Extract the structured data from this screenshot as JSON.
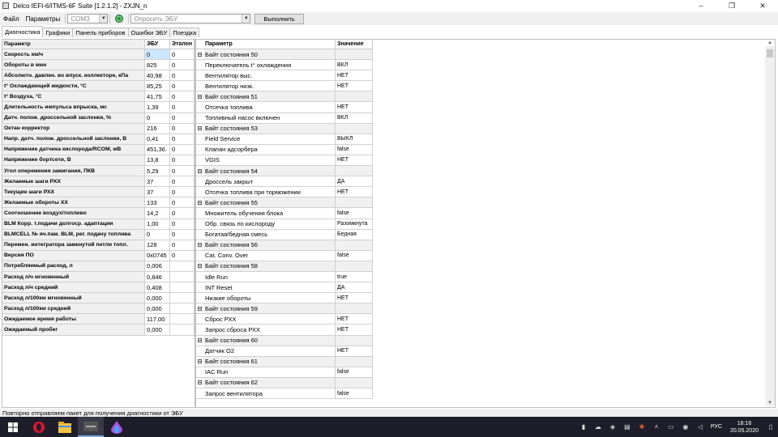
{
  "window": {
    "title": "Delco IEFI-6/ITMS-6F Suite [1.2.1.2] - ZXJN_n",
    "controls": [
      "–",
      "❐",
      "✕"
    ]
  },
  "toolbar": {
    "menu_file": "Файл",
    "menu_params": "Параметры",
    "port_value": "COM3",
    "request_placeholder": "Опросить ЭБУ",
    "run_button": "Выполнить"
  },
  "tabs": [
    "Диагностика",
    "Графики",
    "Панель приборов",
    "Ошибки ЭБУ",
    "Поездка"
  ],
  "left_table": {
    "headers": [
      "Параметр",
      "ЭБУ",
      "Эталон"
    ],
    "rows": [
      [
        "Скорость км/ч",
        "0",
        "0"
      ],
      [
        "Обороты в мин",
        "825",
        "0"
      ],
      [
        "Абсолютн. давлен. во впуск. коллекторе, кПа",
        "40,98",
        "0"
      ],
      [
        "t° Охлаждающей жидкости, °C",
        "85,25",
        "0"
      ],
      [
        "t° Воздуха, °C",
        "41,75",
        "0"
      ],
      [
        "Длительность импульса впрыска, мс",
        "1,39",
        "0"
      ],
      [
        "Датч. полож. дроссельной заслонки, %",
        "0",
        "0"
      ],
      [
        "Октан корректор",
        "216",
        "0"
      ],
      [
        "Напр. датч. полож. дроссельной заслонки, В",
        "0,41",
        "0"
      ],
      [
        "Напряжение датчика кислорода/RCOM, мВ",
        "451,36",
        "0"
      ],
      [
        "Напряжение бортсети, В",
        "13,8",
        "0"
      ],
      [
        "Угол опережения зажигания, ПКВ",
        "5,29",
        "0"
      ],
      [
        "Желаемые шаги РХХ",
        "37",
        "0"
      ],
      [
        "Текущие шаги РХХ",
        "37",
        "0"
      ],
      [
        "Желаемые обороты ХХ",
        "133",
        "0"
      ],
      [
        "Соотношение воздух/топливо",
        "14,2",
        "0"
      ],
      [
        "BLM Корр. т.подачи долгоср. адаптации",
        "1,00",
        "0"
      ],
      [
        "BLMCELL № яч.пам. BLM, рег. подачу топлива",
        "0",
        "0"
      ],
      [
        "Перемен. интегратора замкнутой петли топл.",
        "128",
        "0"
      ],
      [
        "Версия ПО",
        "0x0745",
        "0"
      ],
      [
        "Потребляемый расход, л",
        "0,006",
        ""
      ],
      [
        "Расход л/ч мгновенный",
        "0,846",
        ""
      ],
      [
        "Расход л/ч средний",
        "0,408",
        ""
      ],
      [
        "Расход л/100км мгновенный",
        "0,000",
        ""
      ],
      [
        "Расход л/100км средний",
        "0,000",
        ""
      ],
      [
        "Ожидаемое время работы",
        "117,00",
        ""
      ],
      [
        "Ожидаемый пробег",
        "0,000",
        ""
      ]
    ]
  },
  "right_table": {
    "headers": [
      "Параметр",
      "Значение"
    ],
    "rows": [
      {
        "group": true,
        "name": "Байт состояния 50",
        "value": ""
      },
      {
        "group": false,
        "name": "Переключатель t° охлаждения",
        "value": "ВКЛ"
      },
      {
        "group": false,
        "name": "Вентилятор выс.",
        "value": "НЕТ"
      },
      {
        "group": false,
        "name": "Вентилятор низк.",
        "value": "НЕТ"
      },
      {
        "group": true,
        "name": "Байт состояния 51",
        "value": ""
      },
      {
        "group": false,
        "name": "Отсечка топлива",
        "value": "НЕТ"
      },
      {
        "group": false,
        "name": "Топливный насос включен",
        "value": "ВКЛ"
      },
      {
        "group": true,
        "name": "Байт состояния 53",
        "value": ""
      },
      {
        "group": false,
        "name": "Field Service",
        "value": "ВЫКЛ"
      },
      {
        "group": false,
        "name": "Клапан адсорбера",
        "value": "false"
      },
      {
        "group": false,
        "name": "VGIS",
        "value": "НЕТ"
      },
      {
        "group": true,
        "name": "Байт состояния 54",
        "value": ""
      },
      {
        "group": false,
        "name": "Дроссель закрыт",
        "value": "ДА"
      },
      {
        "group": false,
        "name": "Отсечка топлива при торможении",
        "value": "НЕТ"
      },
      {
        "group": true,
        "name": "Байт состояния 55",
        "value": ""
      },
      {
        "group": false,
        "name": "Множитель обучения блока",
        "value": "false"
      },
      {
        "group": false,
        "name": "Обр. связь по кислороду",
        "value": "Разомкнута"
      },
      {
        "group": false,
        "name": "Богатая/бедная смесь",
        "value": "Бедная"
      },
      {
        "group": true,
        "name": "Байт состояния 56",
        "value": ""
      },
      {
        "group": false,
        "name": "Cat. Conv. Over",
        "value": "false"
      },
      {
        "group": true,
        "name": "Байт состояния 58",
        "value": ""
      },
      {
        "group": false,
        "name": "Idle Run",
        "value": "true"
      },
      {
        "group": false,
        "name": "INT Reset",
        "value": "ДА"
      },
      {
        "group": false,
        "name": "Низкие обороты",
        "value": "НЕТ"
      },
      {
        "group": true,
        "name": "Байт состояния 59",
        "value": ""
      },
      {
        "group": false,
        "name": "Сброс РХХ",
        "value": "НЕТ"
      },
      {
        "group": false,
        "name": "Запрос сброса РХХ",
        "value": "НЕТ"
      },
      {
        "group": true,
        "name": "Байт состояния 60",
        "value": ""
      },
      {
        "group": false,
        "name": "Датчик О2",
        "value": "НЕТ"
      },
      {
        "group": true,
        "name": "Байт состояния 61",
        "value": ""
      },
      {
        "group": false,
        "name": "IAC Run",
        "value": "false"
      },
      {
        "group": true,
        "name": "Байт состояния 62",
        "value": ""
      },
      {
        "group": false,
        "name": "Запрос вентилятора",
        "value": "false"
      }
    ]
  },
  "statusbar": {
    "text": "Повторно отправляем пакет для получения диагностики от ЭБУ"
  },
  "taskbar": {
    "lang": "РУС",
    "time": "18:16",
    "date": "20.05.2020"
  },
  "colors": {
    "selection": "#cce8ff",
    "status_ok": "#2a8a3a",
    "taskbar": "#1e1e2a"
  }
}
